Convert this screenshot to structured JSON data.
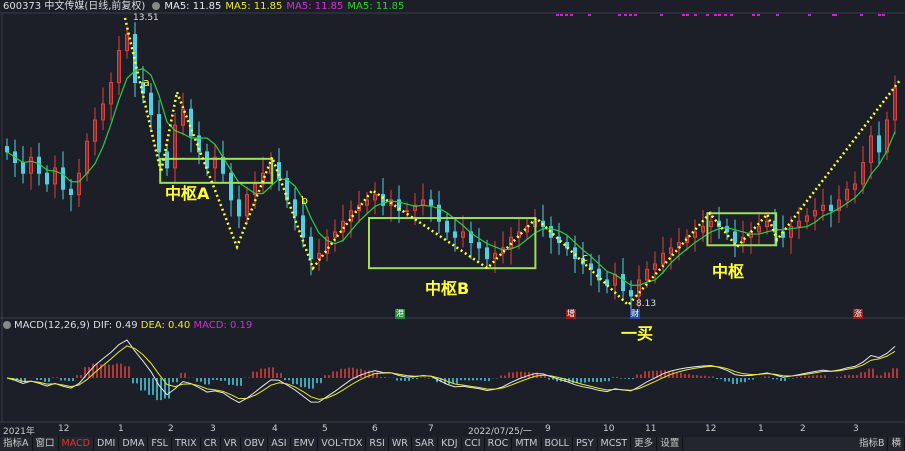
{
  "header": {
    "title": "600373 中文传媒(日线,前复权)",
    "ma": [
      "MA5: 11.85",
      "MA5: 11.85",
      "MA5: 11.85",
      "MA5: 11.85"
    ]
  },
  "colors": {
    "up": "#e0403a",
    "down": "#4fd0e0",
    "ma": "#2ecc40",
    "zigzag": "#ffff33",
    "box": "#9be05a",
    "bg": "#1c1f27"
  },
  "chart_data": {
    "type": "candlestick",
    "title": "600373 中文传媒(日线,前复权)",
    "ylim": [
      8.13,
      13.51
    ],
    "high_label": "13.51",
    "low_label": "8.13",
    "closes": [
      11.0,
      10.8,
      10.6,
      10.9,
      10.6,
      10.4,
      10.7,
      10.3,
      10.2,
      10.6,
      11.2,
      11.6,
      11.9,
      12.3,
      12.9,
      13.2,
      12.3,
      12.1,
      11.7,
      11.0,
      10.7,
      11.5,
      11.8,
      11.3,
      11.0,
      10.7,
      10.9,
      10.6,
      10.1,
      9.8,
      10.2,
      10.4,
      10.6,
      10.8,
      10.5,
      10.1,
      9.8,
      9.4,
      9.0,
      9.1,
      9.4,
      9.5,
      9.7,
      9.9,
      10.0,
      10.1,
      10.2,
      10.0,
      10.1,
      9.9,
      9.9,
      10.0,
      10.1,
      10.0,
      9.7,
      9.5,
      9.4,
      9.5,
      9.3,
      9.2,
      9.0,
      9.1,
      9.2,
      9.4,
      9.5,
      9.6,
      9.7,
      9.6,
      9.4,
      9.3,
      9.2,
      9.0,
      8.9,
      8.8,
      8.6,
      8.5,
      8.7,
      8.4,
      8.3,
      8.6,
      8.8,
      8.9,
      9.1,
      9.2,
      9.3,
      9.4,
      9.5,
      9.6,
      9.7,
      9.6,
      9.5,
      9.3,
      9.4,
      9.5,
      9.6,
      9.7,
      9.5,
      9.4,
      9.6,
      9.7,
      9.8,
      9.9,
      10.0,
      9.9,
      10.1,
      10.3,
      10.4,
      10.8,
      11.3,
      11.0,
      11.6,
      12.2
    ],
    "zigzag": [
      {
        "i": 15,
        "p": 13.51
      },
      {
        "i": 19.5,
        "p": 10.62
      },
      {
        "i": 21.5,
        "p": 12.12
      },
      {
        "i": 29,
        "p": 9.22
      },
      {
        "i": 33.4,
        "p": 10.9
      },
      {
        "i": 38.5,
        "p": 8.82
      },
      {
        "i": 45.9,
        "p": 10.28
      },
      {
        "i": 60.3,
        "p": 8.82
      },
      {
        "i": 66.4,
        "p": 9.76
      },
      {
        "i": 77.9,
        "p": 8.13
      },
      {
        "i": 88.1,
        "p": 9.85
      },
      {
        "i": 91.5,
        "p": 9.22
      },
      {
        "i": 95.3,
        "p": 9.83
      },
      {
        "i": 96.5,
        "p": 9.35
      },
      {
        "i": 111.9,
        "p": 12.35
      }
    ],
    "pivots": [
      {
        "label": "中枢A",
        "i0": 19.4,
        "i1": 33.4,
        "top": 10.87,
        "bottom": 10.42
      },
      {
        "label": "中枢B",
        "i0": 45.5,
        "i1": 66.3,
        "top": 9.76,
        "bottom": 8.82
      },
      {
        "label": "中枢",
        "i0": 87.8,
        "i1": 96.4,
        "top": 9.85,
        "bottom": 9.25
      }
    ],
    "wave_labels": [
      "a",
      "b",
      "c"
    ],
    "signal_label": "一买",
    "events": [
      "港",
      "增",
      "财",
      "涨"
    ],
    "x_ticks": [
      "2021年",
      "12",
      "1",
      "2",
      "3",
      "4",
      "5",
      "6",
      "7",
      "2022/07/25/一",
      "9",
      "10",
      "11",
      "12",
      "1",
      "2",
      "3"
    ],
    "macd": {
      "title": "MACD(12,26,9)",
      "dif": "DIF: 0.49",
      "dea": "DEA: 0.40",
      "macd": "MACD: 0.19"
    }
  },
  "tabs": [
    "指标A",
    "窗口",
    "MACD",
    "DMI",
    "DMA",
    "FSL",
    "TRIX",
    "CR",
    "VR",
    "OBV",
    "ASI",
    "EMV",
    "VOL-TDX",
    "RSI",
    "WR",
    "SAR",
    "KDJ",
    "CCI",
    "ROC",
    "MTM",
    "BOLL",
    "PSY",
    "MCST",
    "更多",
    "设置"
  ],
  "tabs_right": [
    "指标B",
    "横"
  ]
}
